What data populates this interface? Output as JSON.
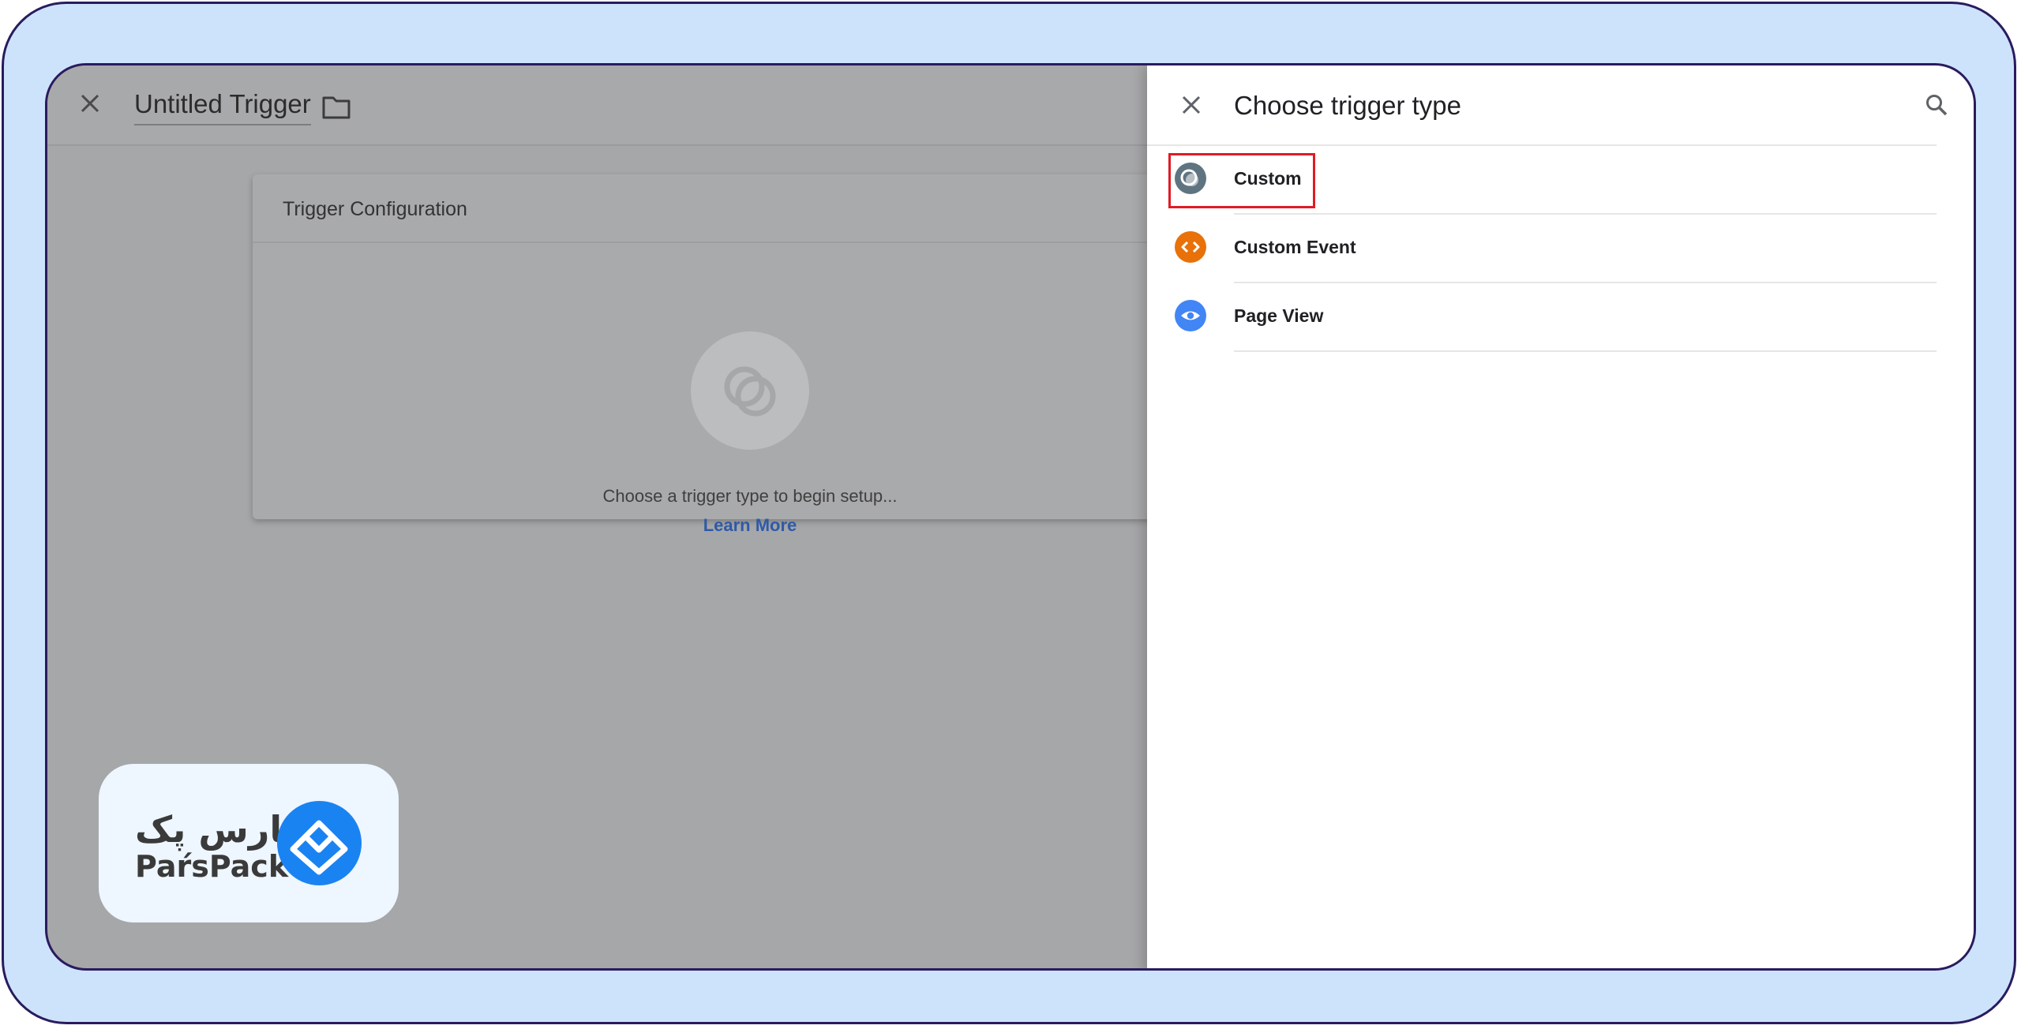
{
  "editor": {
    "title": "Untitled Trigger",
    "card": {
      "title": "Trigger Configuration",
      "placeholder": "Choose a trigger type to begin setup...",
      "learn_more": "Learn More"
    }
  },
  "panel": {
    "title": "Choose trigger type",
    "items": [
      {
        "label": "Custom",
        "icon": "custom-trigger-icon",
        "color": "#5f7481"
      },
      {
        "label": "Custom Event",
        "icon": "code-icon",
        "color": "#e8710a"
      },
      {
        "label": "Page View",
        "icon": "eye-icon",
        "color": "#4285f4"
      }
    ]
  },
  "logo": {
    "fa_text": "پارس پک",
    "en_text": "PaŕsPack"
  },
  "colors": {
    "frame_bg": "#cde3fb",
    "frame_border": "#2a1b5e",
    "highlight": "#e01b24",
    "link": "#2f5aa6",
    "brand_blue": "#1a83f2"
  }
}
